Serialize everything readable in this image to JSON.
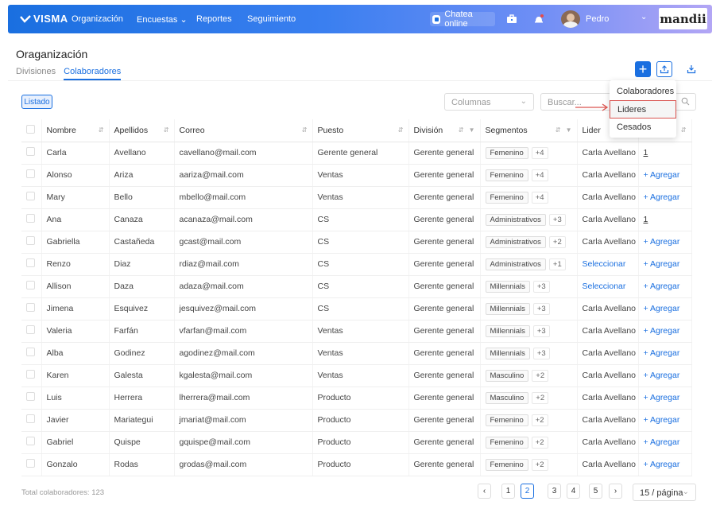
{
  "nav": {
    "logo": "VISMA",
    "items": [
      "Organización",
      "Encuestas",
      "Reportes",
      "Seguimiento"
    ],
    "chat_label": "Chatea online",
    "user_name": "Pedro",
    "brand": "mandii"
  },
  "header": {
    "title": "Oraganización",
    "tabs": [
      "Divisiones",
      "Colaboradores"
    ],
    "active_tab": "Colaboradores"
  },
  "toolbar": {
    "view_label": "Listado",
    "columns_placeholder": "Columnas",
    "search_placeholder": "Buscar..."
  },
  "dropdown": {
    "items": [
      "Colaboradores",
      "Lideres",
      "Cesados"
    ],
    "highlighted": "Lideres"
  },
  "table": {
    "headers": [
      "Nombre",
      "Apellidos",
      "Correo",
      "Puesto",
      "División",
      "Segmentos",
      "Lider",
      ""
    ],
    "rows": [
      [
        "Carla",
        "Avellano",
        "cavellano@mail.com",
        "Gerente general",
        "Gerente general",
        "Femenino",
        "+4",
        "Carla Avellano",
        "1"
      ],
      [
        "Alonso",
        "Ariza",
        "aariza@mail.com",
        "Ventas",
        "Gerente general",
        "Femenino",
        "+4",
        "Carla Avellano",
        "+ Agregar"
      ],
      [
        "Mary",
        "Bello",
        "mbello@mail.com",
        "Ventas",
        "Gerente general",
        "Femenino",
        "+4",
        "Carla Avellano",
        "+ Agregar"
      ],
      [
        "Ana",
        "Canaza",
        "acanaza@mail.com",
        "CS",
        "Gerente general",
        "Administrativos",
        "+3",
        "Carla Avellano",
        "1"
      ],
      [
        "Gabriella",
        "Castañeda",
        "gcast@mail.com",
        "CS",
        "Gerente general",
        "Administrativos",
        "+2",
        "Carla Avellano",
        "+ Agregar"
      ],
      [
        "Renzo",
        "Diaz",
        "rdiaz@mail.com",
        "CS",
        "Gerente general",
        "Administrativos",
        "+1",
        "Seleccionar",
        "+ Agregar"
      ],
      [
        "Allison",
        "Daza",
        "adaza@mail.com",
        "CS",
        "Gerente general",
        "Millennials",
        "+3",
        "Seleccionar",
        "+ Agregar"
      ],
      [
        "Jimena",
        "Esquivez",
        "jesquivez@mail.com",
        "CS",
        "Gerente general",
        "Millennials",
        "+3",
        "Carla Avellano",
        "+ Agregar"
      ],
      [
        "Valeria",
        "Farfán",
        "vfarfan@mail.com",
        "Ventas",
        "Gerente general",
        "Millennials",
        "+3",
        "Carla Avellano",
        "+ Agregar"
      ],
      [
        "Alba",
        "Godinez",
        "agodinez@mail.com",
        "Ventas",
        "Gerente general",
        "Millennials",
        "+3",
        "Carla Avellano",
        "+ Agregar"
      ],
      [
        "Karen",
        "Galesta",
        "kgalesta@mail.com",
        "Ventas",
        "Gerente general",
        "Masculino",
        "+2",
        "Carla Avellano",
        "+ Agregar"
      ],
      [
        "Luis",
        "Herrera",
        "lherrera@mail.com",
        "Producto",
        "Gerente general",
        "Masculino",
        "+2",
        "Carla Avellano",
        "+ Agregar"
      ],
      [
        "Javier",
        "Mariategui",
        "jmariat@mail.com",
        "Producto",
        "Gerente general",
        "Femenino",
        "+2",
        "Carla Avellano",
        "+ Agregar"
      ],
      [
        "Gabriel",
        "Quispe",
        "gquispe@mail.com",
        "Producto",
        "Gerente general",
        "Femenino",
        "+2",
        "Carla Avellano",
        "+ Agregar"
      ],
      [
        "Gonzalo",
        "Rodas",
        "grodas@mail.com",
        "Producto",
        "Gerente general",
        "Femenino",
        "+2",
        "Carla Avellano",
        "+ Agregar"
      ]
    ]
  },
  "footer": {
    "total": "Total colaboradores: 123",
    "pages": [
      "1",
      "2",
      "3",
      "4",
      "5"
    ],
    "current_page": "2",
    "per_page": "15 / página"
  },
  "colors": {
    "accent": "#1a6fe0",
    "highlight": "#d9534f"
  }
}
